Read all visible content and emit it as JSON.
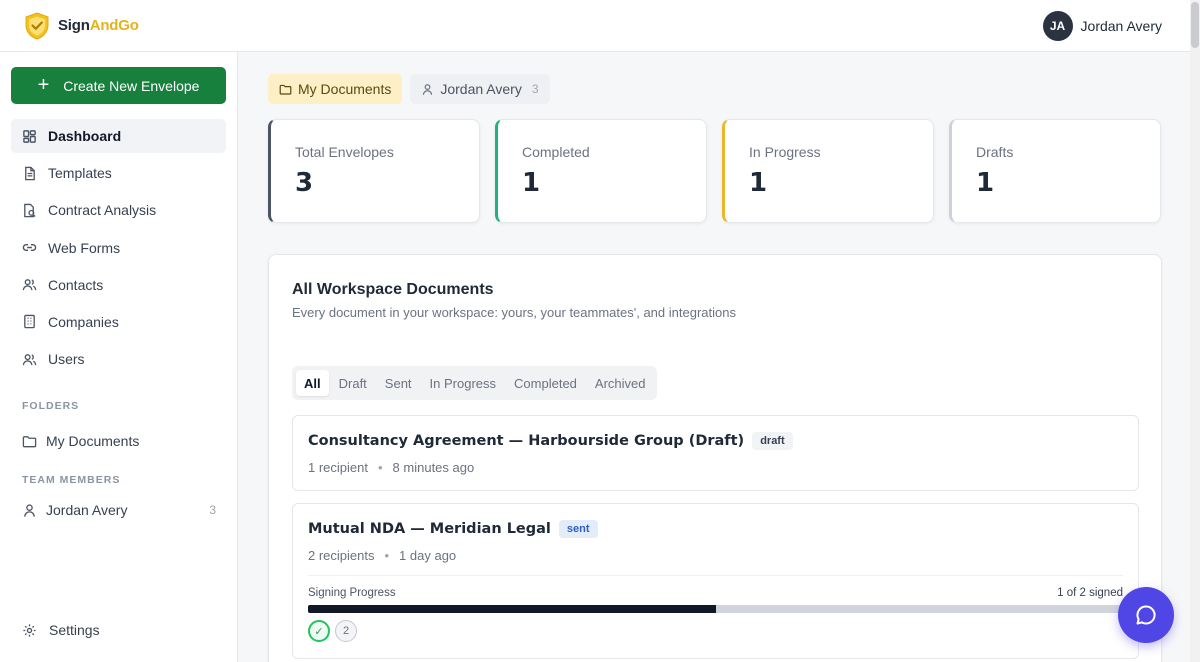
{
  "app": {
    "name_main": "Sign",
    "name_accent": "AndGo",
    "name_tail": ""
  },
  "user": {
    "initials": "JA",
    "name": "Jordan Avery"
  },
  "sidebar": {
    "create_label": "Create New Envelope",
    "items": [
      {
        "label": "Dashboard",
        "icon": "dashboard-icon",
        "active": true
      },
      {
        "label": "Templates",
        "icon": "file-icon"
      },
      {
        "label": "Contract Analysis",
        "icon": "document-analysis-icon"
      },
      {
        "label": "Web Forms",
        "icon": "link-icon"
      },
      {
        "label": "Contacts",
        "icon": "contacts-icon"
      },
      {
        "label": "Companies",
        "icon": "building-icon"
      },
      {
        "label": "Users",
        "icon": "users-icon"
      }
    ],
    "folders_heading": "FOLDERS",
    "folder_my_documents": "My Documents",
    "team_heading": "TEAM MEMBERS",
    "team_member": {
      "name": "Jordan Avery",
      "count": "3"
    },
    "settings_label": "Settings"
  },
  "filters": {
    "my_documents": "My Documents",
    "member": "Jordan Avery",
    "member_count": "3"
  },
  "stats": [
    {
      "label": "Total Envelopes",
      "value": "3",
      "accent": "#4b5563"
    },
    {
      "label": "Completed",
      "value": "1",
      "accent": "#22b07d"
    },
    {
      "label": "In Progress",
      "value": "1",
      "accent": "#e9b82a"
    },
    {
      "label": "Drafts",
      "value": "1",
      "accent": "#cbd2da"
    }
  ],
  "workspace": {
    "title": "All Workspace Documents",
    "subtitle": "Every document in your workspace: yours, your teammates', and integrations",
    "tabs": [
      "All",
      "Draft",
      "Sent",
      "In Progress",
      "Completed",
      "Archived"
    ],
    "active_tab": "All"
  },
  "documents": [
    {
      "title": "Consultancy Agreement — Harbourside Group (Draft)",
      "status": "draft",
      "recipients": "1 recipient",
      "time": "8 minutes ago"
    },
    {
      "title": "Mutual NDA — Meridian Legal",
      "status": "sent",
      "recipients": "2 recipients",
      "time": "1 day ago",
      "progress_label": "Signing Progress",
      "progress_count": "1 of 2 signed",
      "progress_fraction": 0.5,
      "signers": [
        {
          "state": "signed",
          "label": "✓"
        },
        {
          "state": "pending",
          "label": "2"
        }
      ]
    }
  ],
  "colors": {
    "brand_green": "#17803d",
    "brand_yellow": "#e4b21b",
    "chat_fab": "#4f46e5"
  }
}
